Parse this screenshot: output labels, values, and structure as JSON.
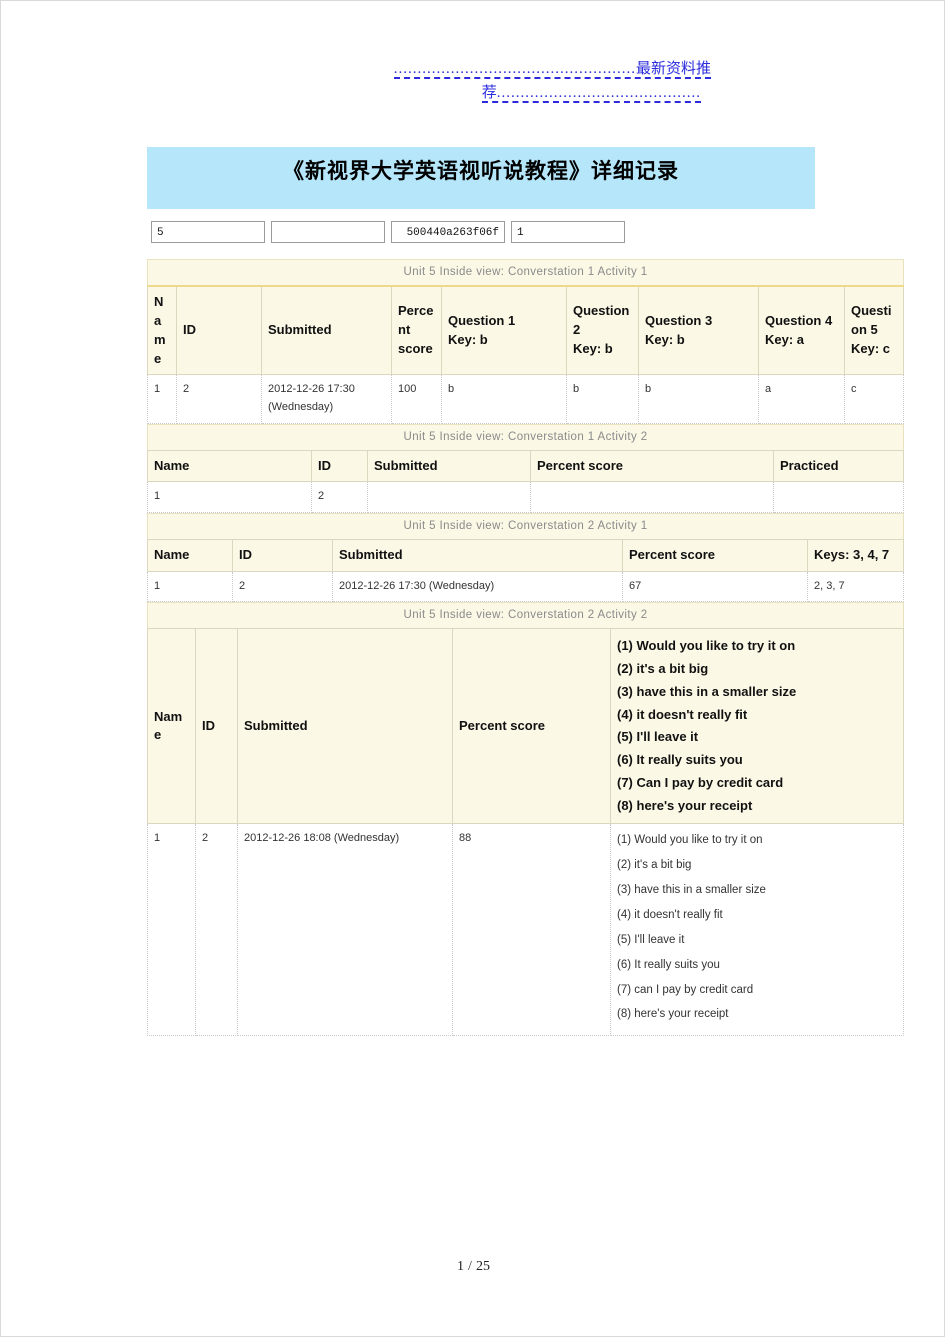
{
  "header": {
    "dots_line1": "...................................................",
    "text_line1": "最新资料推",
    "text_line2": "荐",
    "dots_line2": "..........................................."
  },
  "title": {
    "text": "《新视界大学英语视听说教程》详细记录"
  },
  "inputs": [
    {
      "name": "field-1",
      "value": "5"
    },
    {
      "name": "field-2",
      "value": ""
    },
    {
      "name": "field-3",
      "value": "500440a263f06f"
    },
    {
      "name": "field-4",
      "value": "1"
    }
  ],
  "tables": [
    {
      "caption": "Unit 5 Inside view: Converstation 1 Activity 1",
      "headers": [
        "Name",
        "ID",
        "Submitted",
        "Percent score",
        "Question 1\nKey: b",
        "Question 2\nKey: b",
        "Question 3\nKey: b",
        "Question 4\nKey: a",
        "Question 5\nKey: c"
      ],
      "header_parts": [
        {
          "line1": "Name",
          "line2": ""
        },
        {
          "line1": "ID",
          "line2": ""
        },
        {
          "line1": "Submitted",
          "line2": ""
        },
        {
          "line1": "Percent score",
          "line2": ""
        },
        {
          "line1": "Question 1",
          "line2": "Key: b"
        },
        {
          "line1": "Question 2",
          "line2": "Key: b"
        },
        {
          "line1": "Question 3",
          "line2": "Key: b"
        },
        {
          "line1": "Question 4",
          "line2": "Key: a"
        },
        {
          "line1": "Question 5",
          "line2": "Key: c"
        }
      ],
      "rows": [
        [
          "1",
          "2",
          "2012-12-26 17:30 (Wednesday)",
          "100",
          "b",
          "b",
          "b",
          "a",
          "c"
        ]
      ]
    },
    {
      "caption": "Unit 5 Inside view: Converstation 1 Activity 2",
      "headers": [
        "Name",
        "ID",
        "Submitted",
        "Percent score",
        "Practiced"
      ],
      "rows": [
        [
          "1",
          "2",
          "",
          "",
          ""
        ]
      ]
    },
    {
      "caption": "Unit 5 Inside view: Converstation 2 Activity 1",
      "headers": [
        "Name",
        "ID",
        "Submitted",
        "Percent score",
        "Keys: 3, 4, 7"
      ],
      "rows": [
        [
          "1",
          "2",
          "2012-12-26 17:30 (Wednesday)",
          "67",
          "2, 3, 7"
        ]
      ]
    },
    {
      "caption": "Unit 5 Inside view: Converstation 2 Activity 2",
      "headers": [
        "Name",
        "ID",
        "Submitted",
        "Percent score",
        "keys-column"
      ],
      "header_keys": [
        "(1) Would you like to try it on",
        "(2) it's a bit big",
        "(3) have this in a smaller size",
        "(4) it doesn't really fit",
        "(5) I'll leave it",
        "(6) It really suits you",
        "(7) Can I pay by credit card",
        "(8) here's your receipt"
      ],
      "row_values": [
        "1",
        "2",
        "2012-12-26 18:08 (Wednesday)",
        "88"
      ],
      "row_keys": [
        "(1) Would you like to try it on",
        "(2) it's a bit big",
        "(3) have this in a smaller size",
        "(4) it doesn't really fit",
        "(5) I'll leave it",
        "(6) It really suits you",
        "(7) can I pay by credit card",
        "(8) here's your receipt"
      ]
    }
  ],
  "footer": {
    "current_page": "1",
    "separator": "/",
    "total_pages": "25"
  },
  "colors": {
    "banner": "#b5e6fa",
    "table_header_bg": "#fbf8e6",
    "header_text": "#2b2bdd"
  }
}
